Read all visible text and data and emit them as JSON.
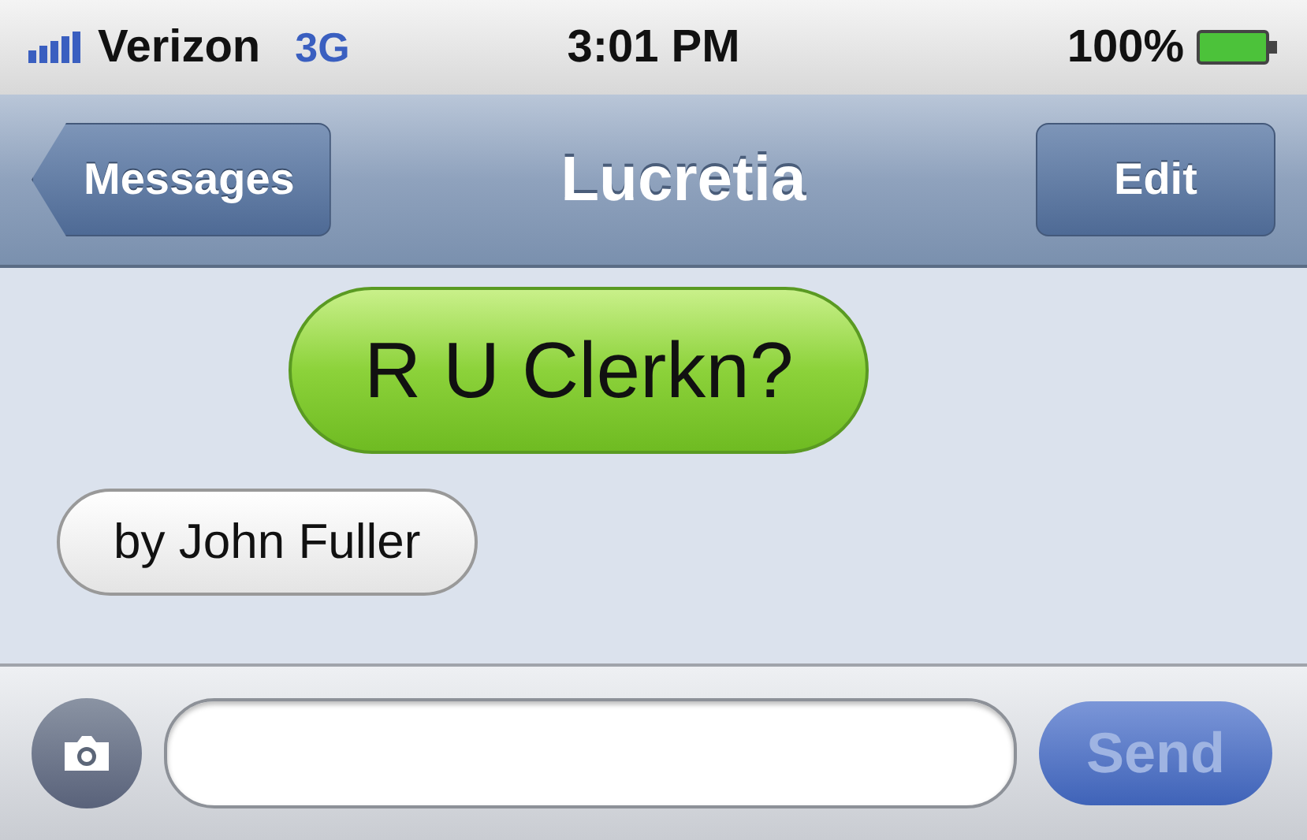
{
  "status_bar": {
    "carrier": "Verizon",
    "network": "3G",
    "time": "3:01 PM",
    "battery": "100%"
  },
  "nav_bar": {
    "back": "Messages",
    "title": "Lucretia",
    "action": "Edit"
  },
  "messages": [
    {
      "kind": "sent",
      "text": "R U Clerkn?"
    },
    {
      "kind": "received",
      "text": "by John Fuller"
    }
  ],
  "composer": {
    "send": "Send",
    "send_disabled": true
  }
}
